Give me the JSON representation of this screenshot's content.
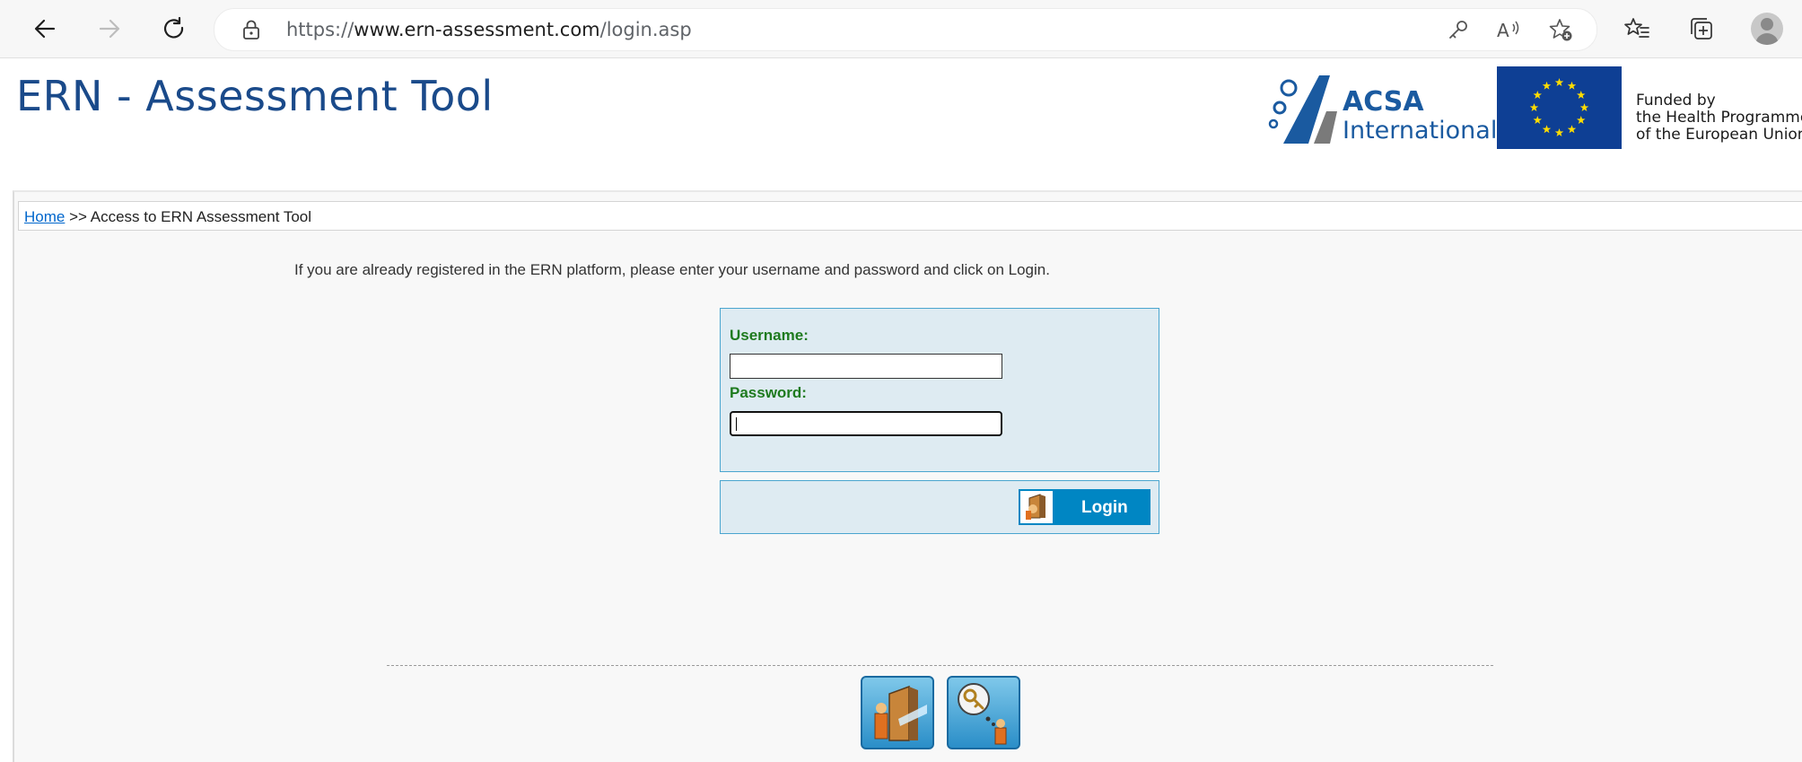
{
  "browser": {
    "url_prefix": "https://",
    "url_host": "www.ern-assessment.com",
    "url_path": "/login.asp"
  },
  "header": {
    "title": "ERN - Assessment Tool",
    "partner_logo": {
      "name": "ACSA",
      "subtitle": "International"
    },
    "funding_lines": [
      "Funded by",
      "the Health Programme",
      "of the European Union"
    ]
  },
  "breadcrumb": {
    "home_link": "Home",
    "current": ">> Access to ERN Assessment Tool"
  },
  "intro_text": "If you are already registered in the ERN platform, please enter your username and password and click on Login.",
  "login_form": {
    "username_label": "Username:",
    "username_value": "",
    "password_label": "Password:",
    "password_value": "",
    "login_button": "Login"
  },
  "colors": {
    "title_blue": "#1a4a8a",
    "label_green": "#1e7a1e",
    "button_blue": "#0086c3",
    "form_background": "#deebf2",
    "eu_blue": "#0e3f94",
    "eu_star": "#ffdd00"
  },
  "icons": {
    "back": "back-arrow-icon",
    "forward": "forward-arrow-icon",
    "reload": "reload-icon",
    "site_info": "lock-icon",
    "password_manager": "key-icon",
    "read_aloud": "read-aloud-icon",
    "add_favorite": "add-favorite-icon",
    "favorites": "favorites-icon",
    "collections": "collections-icon",
    "profile": "profile-avatar-icon",
    "login_door": "door-icon",
    "access": "access-door-icon",
    "forgot_password": "forgot-password-icon"
  }
}
